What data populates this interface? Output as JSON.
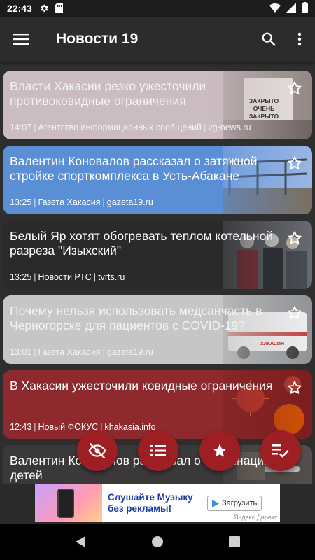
{
  "status_bar": {
    "time": "22:43"
  },
  "app_bar": {
    "title": "Новости 19",
    "icons": [
      "menu-icon",
      "search-icon",
      "more-vert-icon"
    ]
  },
  "articles": [
    {
      "headline": "Власти Хакасии резко ужесточили противоковидные ограничения",
      "time": "14:07",
      "source": "Агентство информационных сообщений",
      "domain": "vg-news.ru",
      "color": "#c8b8bf",
      "image_text": "ЗАКРЫТО ОЧЕНЬ ЗАКРЫТО",
      "read": true
    },
    {
      "headline": "Валентин Коновалов рассказал о затяжной стройке спорткомплекса в Усть-Абакане",
      "time": "13:25",
      "source": "Газета Хакасия",
      "domain": "gazeta19.ru",
      "color": "#5a8fd6",
      "read": false
    },
    {
      "headline": "Белый Яр хотят обогревать теплом котельной разреза \"Изыхский\"",
      "time": "13:25",
      "source": "Новости РТС",
      "domain": "tvrts.ru",
      "color": "#2a2a2a",
      "read": false
    },
    {
      "headline": "Почему нельзя использовать медсанчасть в Черногорске для пациентов с COVID-19?",
      "time": "13:01",
      "source": "Газета Хакасия",
      "domain": "gazeta19.ru",
      "color": "#c4c4c4",
      "image_text": "ХАКАСИЯ",
      "read": true
    },
    {
      "headline": "В Хакасии ужесточили ковидные ограничения",
      "time": "12:43",
      "source": "Новый ФОКУС",
      "domain": "khakasia.info",
      "color": "#8e2a2e",
      "read": false
    },
    {
      "headline": "Валентин Коновалов рассказал о вакцинации детей",
      "color": "#3a3838",
      "read": false
    }
  ],
  "fabs": [
    "hide-read-icon",
    "list-icon",
    "favorites-star-icon",
    "mark-read-icon"
  ],
  "ad": {
    "headline": "Слушайте Музыку без рекламы!",
    "cta": "Загрузить",
    "label": "Яндекс.Директ"
  },
  "colors": {
    "accent": "#9d1f24",
    "app_bar": "#2c2c2c",
    "background": "#2e2e2e"
  }
}
